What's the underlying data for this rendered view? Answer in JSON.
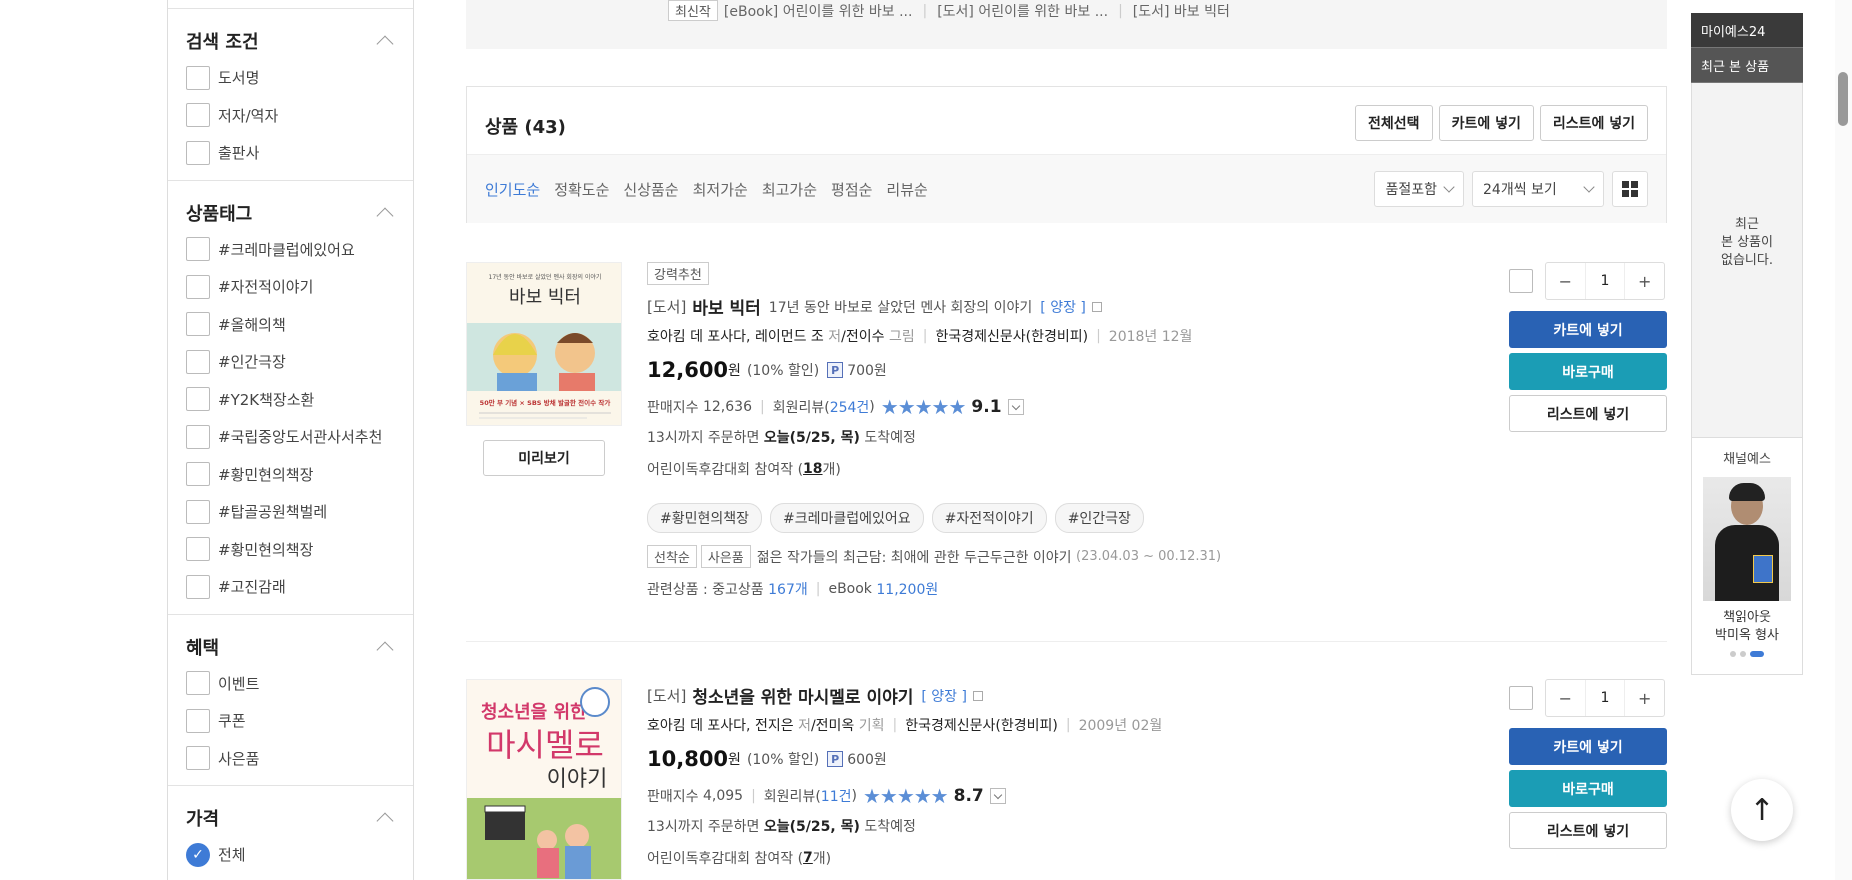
{
  "sidebar": {
    "search": {
      "title": "검색 조건",
      "items": [
        "도서명",
        "저자/역자",
        "출판사"
      ]
    },
    "tags": {
      "title": "상품태그",
      "items": [
        "#크레마클럽에있어요",
        "#자전적이야기",
        "#올해의책",
        "#인간극장",
        "#Y2K책장소환",
        "#국립중앙도서관사서추천",
        "#황민현의책장",
        "#탑골공원책벌레",
        "#황민현의책장",
        "#고진감래"
      ]
    },
    "benefits": {
      "title": "혜택",
      "items": [
        "이벤트",
        "쿠폰",
        "사은품"
      ]
    },
    "price": {
      "title": "가격",
      "items": [
        "전체"
      ]
    }
  },
  "top_strip": {
    "badge": "최신작",
    "items": [
      "[eBook] 어린이를 위한 바보 ...",
      "[도서] 어린이를 위한 바보 ...",
      "[도서] 바보 빅터"
    ]
  },
  "products": {
    "title": "상품",
    "count": "(43)",
    "actions": [
      "전체선택",
      "카트에 넣기",
      "리스트에 넣기"
    ],
    "sorts": [
      "인기도순",
      "정확도순",
      "신상품순",
      "최저가순",
      "최고가순",
      "평점순",
      "리뷰순"
    ],
    "filter_select": "품절포함",
    "per_page_select": "24개씩 보기"
  },
  "items": [
    {
      "badge": "강력추천",
      "category": "[도서]",
      "title": "바보 빅터",
      "subtitle": "17년 동안 바보로 살았던 멘사 회장의 이야기",
      "binding": "[ 양장 ]",
      "authors": "호아킴 데 포사다, 레이먼드 조",
      "author_role": "저",
      "translator": "/전이수",
      "translator_role": "그림",
      "publisher": "한국경제신문사(한경비피)",
      "date": "2018년 12월",
      "price": "12,600",
      "price_unit": "원",
      "discount": "(10% 할인)",
      "points": "700원",
      "sales_label": "판매지수",
      "sales": "12,636",
      "review_label": "회원리뷰(",
      "review_count": "254건",
      "review_close": ")",
      "rating": 9.1,
      "rating_text": "9.1",
      "stars": "★★★★★",
      "delivery_pre": "13시까지 주문하면",
      "delivery_date": "오늘(5/25, 목)",
      "delivery_post": "도착예정",
      "event_pre": "어린이독후감대회 참여작 (",
      "event_count": "18",
      "event_post": "개)",
      "tags": [
        "#황민현의책장",
        "#크레마클럽에있어요",
        "#자전적이야기",
        "#인간극장"
      ],
      "promo_badges": [
        "선착순",
        "사은품"
      ],
      "promo_text": "젊은 작가들의 최근담: 최애에 관한 두근두근한 이야기",
      "promo_period": "(23.04.03 ~ 00.12.31)",
      "related_label": "관련상품 : 중고상품",
      "related_used": "167개",
      "related_ebook_label": "eBook",
      "related_ebook": "11,200원",
      "preview": "미리보기",
      "qty": "1",
      "cover_text": [
        "17년 동안 바보로 살았던 멘사 회장의 이야기",
        "바보 빅터",
        "50만 부 기념 × SBS 방채 발굴한 전이수 작가"
      ]
    },
    {
      "category": "[도서]",
      "title": "청소년을 위한 마시멜로 이야기",
      "binding": "[ 양장 ]",
      "authors": "호아킴 데 포사다, 전지은",
      "author_role": "저",
      "translator": "/전미옥",
      "translator_role": "기획",
      "publisher": "한국경제신문사(한경비피)",
      "date": "2009년 02월",
      "price": "10,800",
      "price_unit": "원",
      "discount": "(10% 할인)",
      "points": "600원",
      "sales_label": "판매지수",
      "sales": "4,095",
      "review_label": "회원리뷰(",
      "review_count": "11건",
      "review_close": ")",
      "rating": 8.7,
      "rating_text": "8.7",
      "stars": "★★★★★",
      "delivery_pre": "13시까지 주문하면",
      "delivery_date": "오늘(5/25, 목)",
      "delivery_post": "도착예정",
      "event_pre": "어린이독후감대회 참여작 (",
      "event_count": "7",
      "event_post": "개)",
      "qty": "1",
      "cover_text": [
        "청소년을 위한",
        "마시멜로",
        "이야기"
      ]
    }
  ],
  "item_buttons": {
    "cart": "카트에 넣기",
    "buy": "바로구매",
    "list": "리스트에 넣기",
    "minus": "−",
    "plus": "+",
    "p_icon": "P"
  },
  "rail": {
    "tab1": "마이예스24",
    "tab2": "최근 본 상품",
    "empty": [
      "최근",
      "본 상품이",
      "없습니다."
    ],
    "channel_title": "채널예스",
    "channel_caption": [
      "책읽아웃",
      "박미옥 형사"
    ]
  },
  "scroll_top": "↑",
  "colors": {
    "accent": "#3e7bd6",
    "cart": "#2962b4",
    "buy": "#1b9db5",
    "star": "#5b8ed6"
  }
}
